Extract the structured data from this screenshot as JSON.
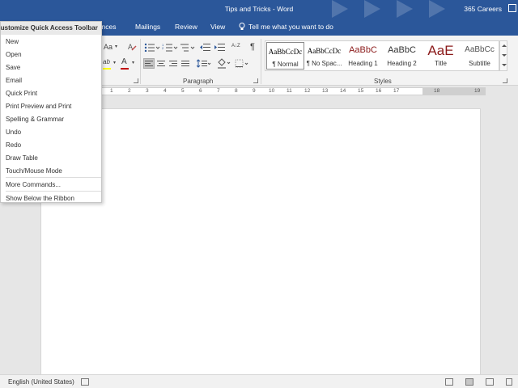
{
  "window": {
    "title": "Tips and Tricks - Word",
    "account": "365 Careers"
  },
  "tabs": {
    "references_partial": "rences",
    "mailings": "Mailings",
    "review": "Review",
    "view": "View",
    "tell_me": "Tell me what you want to do"
  },
  "ribbon": {
    "paragraph_label": "Paragraph",
    "styles_label": "Styles",
    "font_partial": "Aa",
    "pilcrow": "¶",
    "sort": "A↓Z",
    "styles": [
      {
        "preview": "AaBbCcDc",
        "name": "¶ Normal"
      },
      {
        "preview": "AaBbCcDc",
        "name": "¶ No Spac..."
      },
      {
        "preview": "AaBbC",
        "name": "Heading 1"
      },
      {
        "preview": "AaBbC",
        "name": "Heading 2"
      },
      {
        "preview": "AaE",
        "name": "Title"
      },
      {
        "preview": "AaBbCc",
        "name": "Subtitle"
      }
    ],
    "accent_colors": {
      "heading": "#8b1a1a",
      "font_color": "#c00000",
      "highlight": "#ffff00"
    }
  },
  "ruler": {
    "numbers": [
      "1",
      "2",
      "3",
      "4",
      "5",
      "6",
      "7",
      "8",
      "9",
      "10",
      "11",
      "12",
      "13",
      "14",
      "15",
      "16",
      "17",
      "18",
      "19"
    ]
  },
  "qat_menu": {
    "header": "Customize Quick Access Toolbar",
    "items": [
      "New",
      "Open",
      "Save",
      "Email",
      "Quick Print",
      "Print Preview and Print",
      "Spelling & Grammar",
      "Undo",
      "Redo",
      "Draw Table",
      "Touch/Mouse Mode"
    ],
    "more_commands": "More Commands...",
    "show_below": "Show Below the Ribbon"
  },
  "statusbar": {
    "language": "English (United States)"
  }
}
